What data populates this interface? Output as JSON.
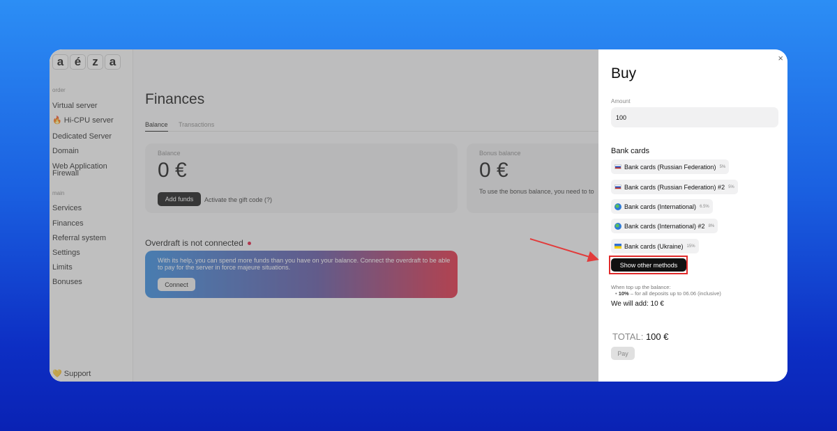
{
  "logo": [
    "a",
    "é",
    "z",
    "a"
  ],
  "sidebar": {
    "section_order": "order",
    "order_items": [
      "Virtual server",
      "🔥 Hi-CPU server",
      "Dedicated Server",
      "Domain",
      "Web Application Firewall"
    ],
    "section_main": "main",
    "main_items": [
      "Services",
      "Finances",
      "Referral system",
      "Settings",
      "Limits",
      "Bonuses"
    ],
    "support": "💛 Support"
  },
  "page": {
    "title": "Finances",
    "tabs": [
      "Balance",
      "Transactions"
    ],
    "balance_card": {
      "label": "Balance",
      "value": "0 €",
      "add_funds": "Add funds",
      "gift_code": "Activate the gift code (?)"
    },
    "bonus_card": {
      "label": "Bonus balance",
      "value": "0 €",
      "note": "To use the bonus balance, you need to to"
    },
    "overdraft": {
      "title": "Overdraft is not connected",
      "text": "With its help, you can spend more funds than you have on your balance. Connect the overdraft to be able to pay for the server in force majeure situations.",
      "connect": "Connect"
    }
  },
  "panel": {
    "title": "Buy",
    "close": "×",
    "amount_label": "Amount",
    "amount_value": "100",
    "section": "Bank cards",
    "methods": [
      {
        "label": "Bank cards (Russian Federation)",
        "pct": "5%",
        "flag": "flag-ru"
      },
      {
        "label": "Bank cards (Russian Federation) #2",
        "pct": "5%",
        "flag": "flag-ru"
      },
      {
        "label": "Bank cards (International)",
        "pct": "6.5%",
        "flag": "globe-icon"
      },
      {
        "label": "Bank cards (International) #2",
        "pct": "8%",
        "flag": "globe-icon"
      },
      {
        "label": "Bank cards (Ukraine)",
        "pct": "15%",
        "flag": "flag-ua"
      }
    ],
    "show_more": "Show other methods",
    "note_heading": "When top up the balance:",
    "note_bonus_pct": "10%",
    "note_bonus_text": " – for all deposits up to 06.06 (inclusive)",
    "will_add": "We will add: 10 €",
    "total_label": "TOTAL:",
    "total_value": "100 €",
    "pay": "Pay"
  },
  "colors": {
    "background_top": "#2c8ef5",
    "background_bottom": "#0a22b4",
    "highlight": "#e02a2a",
    "button_dark": "#111111"
  }
}
